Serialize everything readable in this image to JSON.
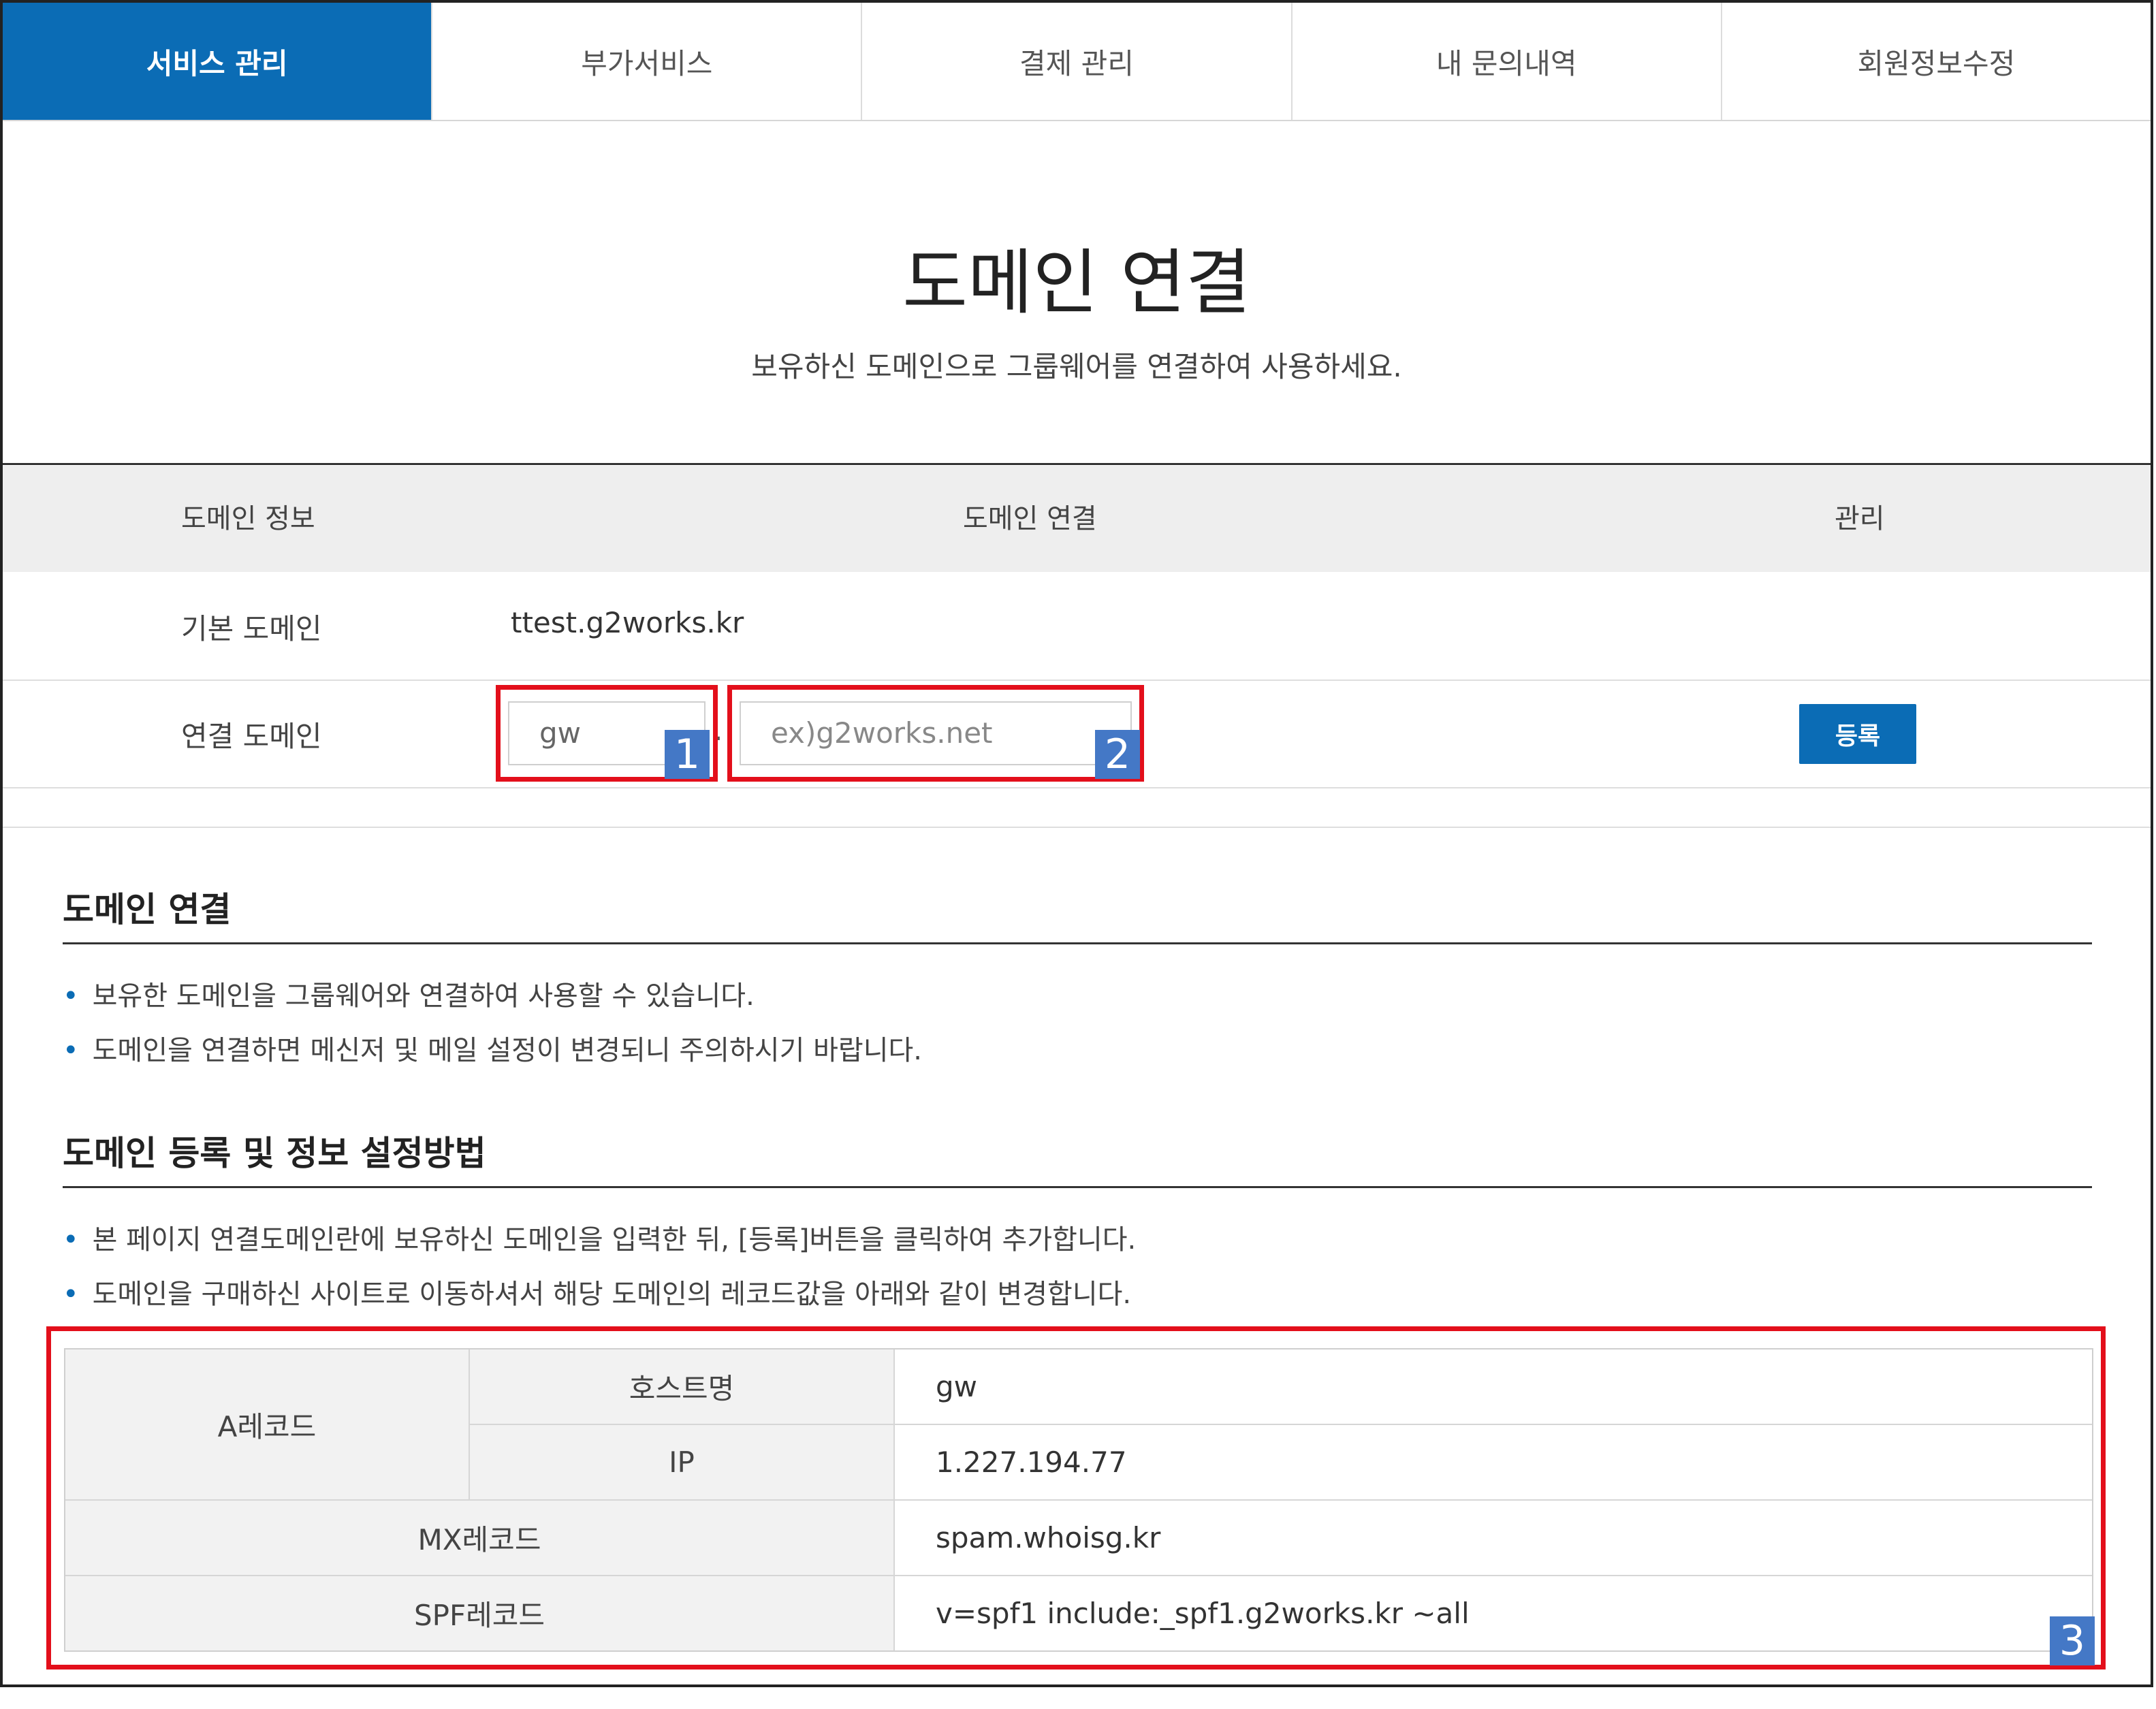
{
  "tabs": [
    "서비스 관리",
    "부가서비스",
    "결제 관리",
    "내 문의내역",
    "회원정보수정"
  ],
  "page": {
    "title": "도메인 연결",
    "subtitle": "보유하신 도메인으로 그룹웨어를 연결하여 사용하세요."
  },
  "table": {
    "headers": [
      "도메인 정보",
      "도메인 연결",
      "관리"
    ],
    "basic_label": "기본 도메인",
    "basic_value": "ttest.g2works.kr",
    "connect_label": "연결 도메인",
    "subdomain_value": "gw",
    "dot": ".",
    "domain_placeholder": "ex)g2works.net",
    "register_button": "등록"
  },
  "badges": [
    "1",
    "2",
    "3"
  ],
  "section1": {
    "title": "도메인 연결",
    "bullets": [
      "보유한 도메인을 그룹웨어와 연결하여 사용할 수 있습니다.",
      "도메인을 연결하면 메신저 및 메일 설정이 변경되니 주의하시기 바랍니다."
    ]
  },
  "section2": {
    "title": "도메인 등록 및 정보 설정방법",
    "bullets": [
      "본 페이지 연결도메인란에 보유하신 도메인을 입력한 뒤, [등록]버튼을 클릭하여 추가합니다.",
      "도메인을 구매하신 사이트로 이동하셔서 해당 도메인의 레코드값을 아래와 같이 변경합니다."
    ]
  },
  "records": {
    "a_record": "A레코드",
    "host_label": "호스트명",
    "host_value": "gw",
    "ip_label": "IP",
    "ip_value": "1.227.194.77",
    "mx_label": "MX레코드",
    "mx_value": "spam.whoisg.kr",
    "spf_label": "SPF레코드",
    "spf_value": "v=spf1 include:_spf1.g2works.kr ~all"
  },
  "colors": {
    "accent": "#0b6cb5",
    "highlight": "#e30f1b",
    "badge": "#4478c6"
  }
}
